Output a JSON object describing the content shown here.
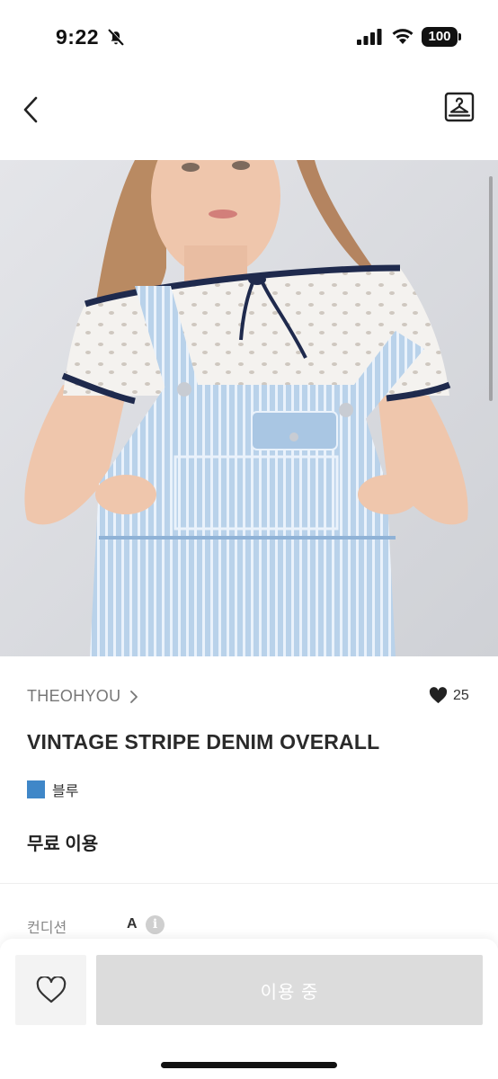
{
  "status_bar": {
    "time": "9:22",
    "battery": "100",
    "icons": [
      "bell-off-icon",
      "signal-icon",
      "wifi-icon",
      "battery-icon"
    ]
  },
  "nav": {
    "back_icon": "chevron-left-icon",
    "action_icon": "hanger-icon"
  },
  "product": {
    "image_icon": "product-photo",
    "brand": "THEOHYOU",
    "like_count": "25",
    "title": "VINTAGE STRIPE DENIM OVERALL",
    "color_name": "블루",
    "color_hex": "#3f87c8",
    "price_label": "무료 이용",
    "condition_label": "컨디션",
    "condition_value": "A",
    "info_icon_glyph": "i"
  },
  "bottom_bar": {
    "wish_icon": "heart-outline-icon",
    "cta_label": "이용 중"
  }
}
